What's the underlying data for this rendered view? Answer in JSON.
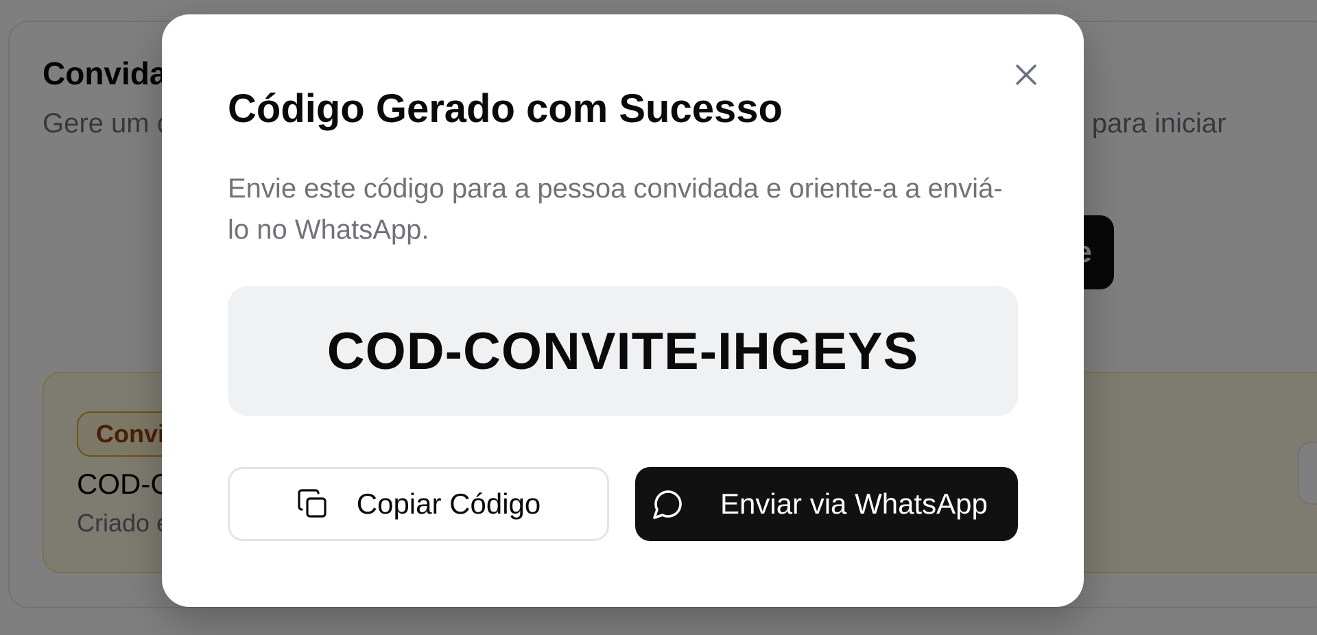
{
  "background": {
    "title": "Convida",
    "description": "Gere um código de convite e compartilhe com a pessoa convidada. Ela poderá enviar para iniciar",
    "generate_button_label": "Gerar Código de Convite",
    "invite_card": {
      "badge": "Convite",
      "code": "COD-CONVITE",
      "created": "Criado em"
    }
  },
  "modal": {
    "title": "Código Gerado com Sucesso",
    "description": "Envie este código para a pessoa convidada e oriente-a a enviá-lo no WhatsApp.",
    "code": "COD-CONVITE-IHGEYS",
    "copy_button_label": "Copiar Código",
    "whatsapp_button_label": "Enviar via WhatsApp",
    "icons": {
      "close": "close-icon",
      "copy": "copy-icon",
      "whatsapp": "message-circle-icon"
    }
  },
  "colors": {
    "primary_button": "#111111",
    "code_box": "#f0f1f3",
    "muted_text": "#71717a",
    "badge_border": "#d7a526",
    "badge_text": "#92400e",
    "invite_card_bg": "#fdf8e3"
  }
}
